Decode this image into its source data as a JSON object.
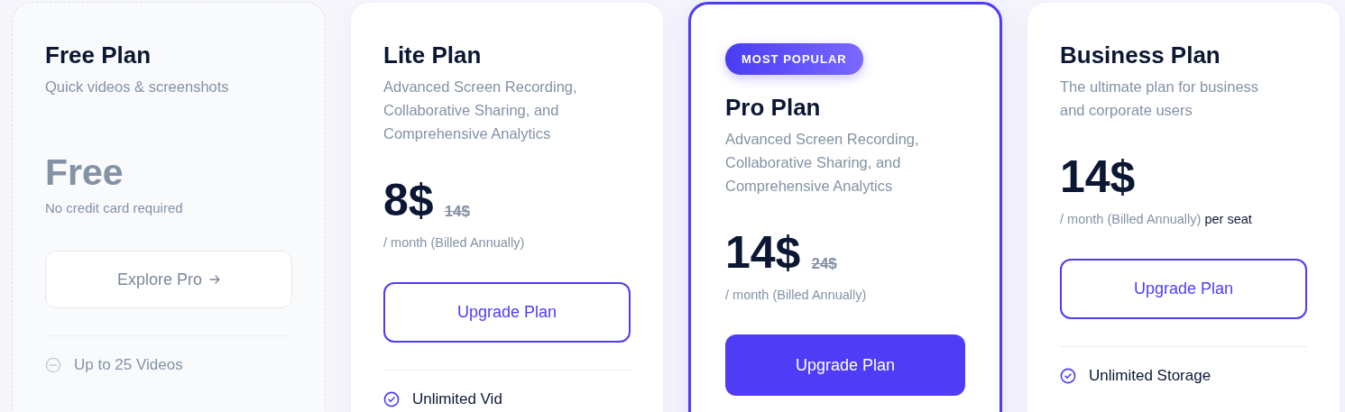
{
  "plans": [
    {
      "kind": "free",
      "featured": false,
      "name": "Free Plan",
      "description": "Quick videos & screenshots",
      "price": "Free",
      "note": "No credit card required",
      "button": {
        "kind": "ghost",
        "label": "Explore Pro",
        "arrow": true
      },
      "features": [
        {
          "text": "Up to 25 Videos",
          "included": false
        }
      ]
    },
    {
      "kind": "paid",
      "featured": false,
      "name": "Lite Plan",
      "description": "Advanced Screen Recording, Collaborative Sharing, and Comprehensive Analytics",
      "price": "8$",
      "old_price": "14$",
      "period": "/ month (Billed Annually)",
      "button": {
        "kind": "outline",
        "label": "Upgrade Plan",
        "arrow": false
      },
      "features": [
        {
          "text": "Unlimited Vid",
          "included": true
        }
      ]
    },
    {
      "kind": "paid",
      "featured": true,
      "badge": "MOST POPULAR",
      "name": "Pro Plan",
      "description": "Advanced Screen Recording, Collaborative Sharing, and Comprehensive Analytics",
      "price": "14$",
      "old_price": "24$",
      "period": "/ month (Billed Annually)",
      "button": {
        "kind": "filled",
        "label": "Upgrade Plan",
        "arrow": false
      }
    },
    {
      "kind": "paid",
      "featured": false,
      "name": "Business Plan",
      "description": "The ultimate plan for business and corporate users",
      "price": "14$",
      "period": "/ month (Billed Annually)",
      "period_suffix": "per seat",
      "button": {
        "kind": "outline",
        "label": "Upgrade Plan",
        "arrow": false
      },
      "features": [
        {
          "text": "Unlimited Storage",
          "included": true
        }
      ]
    }
  ]
}
